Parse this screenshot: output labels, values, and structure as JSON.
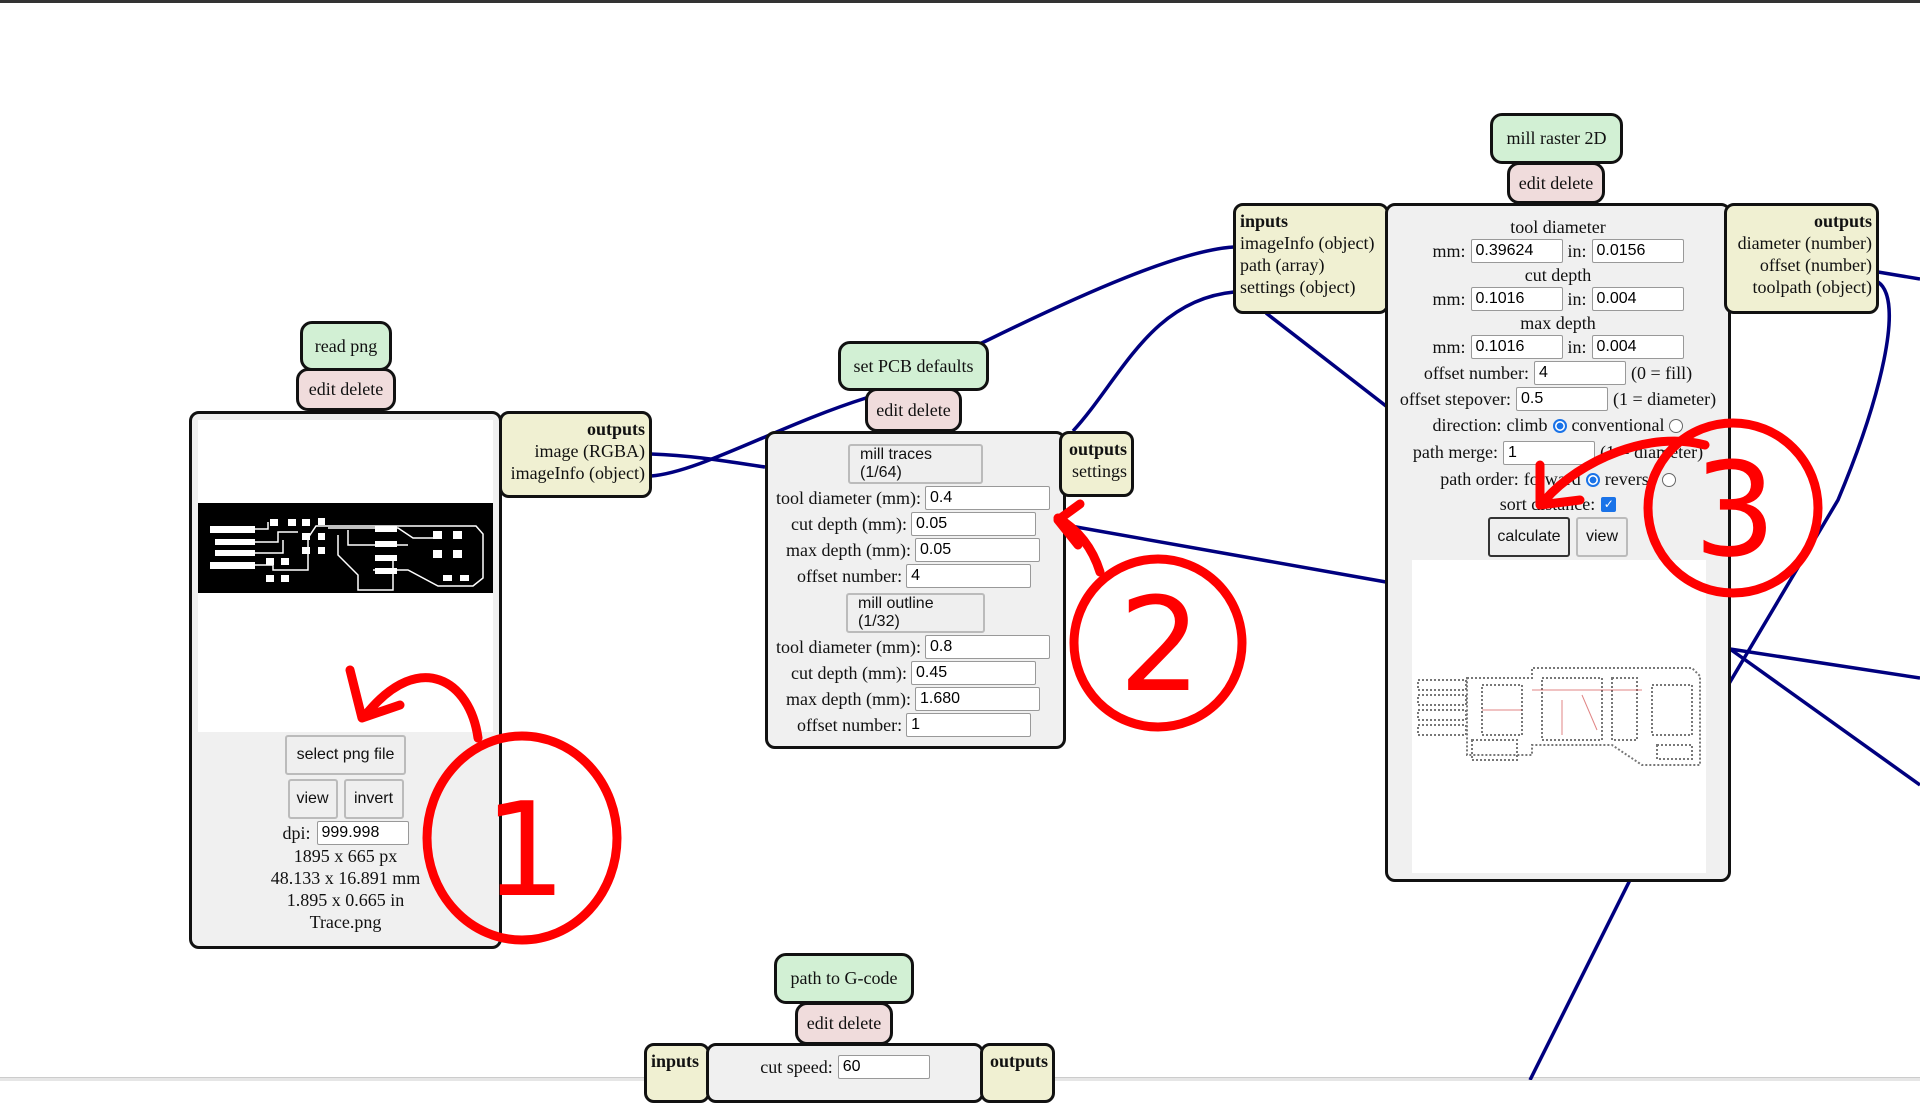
{
  "colors": {
    "wire": "#00007f",
    "annotation": "#ff0000",
    "title_bg": "#d2f0d4",
    "edit_bg": "#f0dcdc",
    "io_bg": "#f0f0d2",
    "body_bg": "#f0f0f0"
  },
  "read_png": {
    "title": "read png",
    "edit_delete": "edit delete",
    "outputs": {
      "heading": "outputs",
      "items": [
        "image (RGBA)",
        "imageInfo (object)"
      ]
    },
    "select_button": "select png file",
    "view_button": "view",
    "invert_button": "invert",
    "dpi_label": "dpi:",
    "dpi_value": "999.998",
    "size_px": "1895 x 665 px",
    "size_mm": "48.133 x 16.891 mm",
    "size_in": "1.895 x 0.665 in",
    "filename": "Trace.png"
  },
  "pcb_defaults": {
    "title": "set PCB defaults",
    "edit_delete": "edit delete",
    "outputs": {
      "heading": "outputs",
      "items": [
        "settings"
      ]
    },
    "traces_button": "mill traces (1/64)",
    "traces": {
      "tool_diameter_label": "tool diameter (mm):",
      "tool_diameter": "0.4",
      "cut_depth_label": "cut depth (mm):",
      "cut_depth": "0.05",
      "max_depth_label": "max depth (mm):",
      "max_depth": "0.05",
      "offset_number_label": "offset number:",
      "offset_number": "4"
    },
    "outline_button": "mill outline (1/32)",
    "outline": {
      "tool_diameter_label": "tool diameter (mm):",
      "tool_diameter": "0.8",
      "cut_depth_label": "cut depth (mm):",
      "cut_depth": "0.45",
      "max_depth_label": "max depth (mm):",
      "max_depth": "1.680",
      "offset_number_label": "offset number:",
      "offset_number": "1"
    }
  },
  "mill_raster": {
    "title": "mill raster 2D",
    "edit_delete": "edit delete",
    "inputs": {
      "heading": "inputs",
      "items": [
        "imageInfo (object)",
        "path (array)",
        "settings (object)"
      ]
    },
    "outputs": {
      "heading": "outputs",
      "items": [
        "diameter (number)",
        "offset (number)",
        "toolpath (object)"
      ]
    },
    "tool_diameter_heading": "tool diameter",
    "cut_depth_heading": "cut depth",
    "max_depth_heading": "max depth",
    "mm_label": "mm:",
    "in_label": "in:",
    "tool_diameter_mm": "0.39624",
    "tool_diameter_in": "0.0156",
    "cut_depth_mm": "0.1016",
    "cut_depth_in": "0.004",
    "max_depth_mm": "0.1016",
    "max_depth_in": "0.004",
    "offset_number_label": "offset number:",
    "offset_number": "4",
    "offset_number_hint": "(0 = fill)",
    "offset_stepover_label": "offset stepover:",
    "offset_stepover": "0.5",
    "offset_stepover_hint": "(1 = diameter)",
    "direction_label": "direction:",
    "direction_climb": "climb",
    "direction_conventional": "conventional",
    "direction_selected": "climb",
    "path_merge_label": "path merge:",
    "path_merge": "1",
    "path_merge_hint": "(1 = diameter)",
    "path_order_label": "path order:",
    "path_order_forward": "forward",
    "path_order_reverse": "reverse",
    "path_order_selected": "forward",
    "sort_distance_label": "sort distance:",
    "sort_distance_checked": true,
    "calculate_button": "calculate",
    "view_button": "view"
  },
  "gcode": {
    "title": "path to G-code",
    "edit_delete": "edit delete",
    "inputs": {
      "heading": "inputs"
    },
    "outputs": {
      "heading": "outputs"
    },
    "cut_speed_label": "cut speed:",
    "cut_speed": "60"
  },
  "annotations": [
    "1",
    "2",
    "3"
  ]
}
